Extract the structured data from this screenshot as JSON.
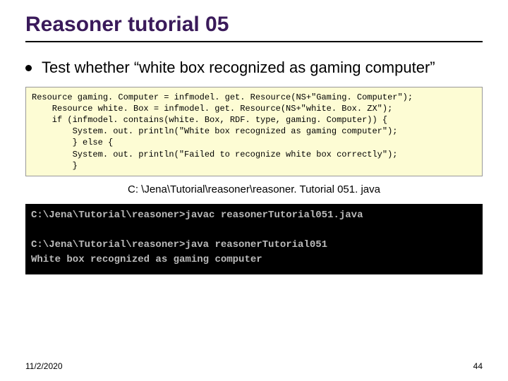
{
  "title": "Reasoner tutorial 05",
  "bullet": "Test whether “white box recognized as gaming computer”",
  "code": {
    "l1": "Resource gaming. Computer = infmodel. get. Resource(NS+\"Gaming. Computer\");",
    "l2": "    Resource white. Box = infmodel. get. Resource(NS+\"white. Box. ZX\");",
    "l3": "    if (infmodel. contains(white. Box, RDF. type, gaming. Computer)) {",
    "l4": "        System. out. println(\"White box recognized as gaming computer\");",
    "l5": "        } else {",
    "l6": "        System. out. println(\"Failed to recognize white box correctly\");",
    "l7": "        }"
  },
  "filepath": "C: \\Jena\\Tutorial\\reasoner\\reasoner. Tutorial 051. java",
  "terminal": {
    "l1": "C:\\Jena\\Tutorial\\reasoner>javac reasonerTutorial051.java",
    "l2": "",
    "l3": "C:\\Jena\\Tutorial\\reasoner>java reasonerTutorial051",
    "l4": "White box recognized as gaming computer"
  },
  "footer": {
    "date": "11/2/2020",
    "page": "44"
  }
}
